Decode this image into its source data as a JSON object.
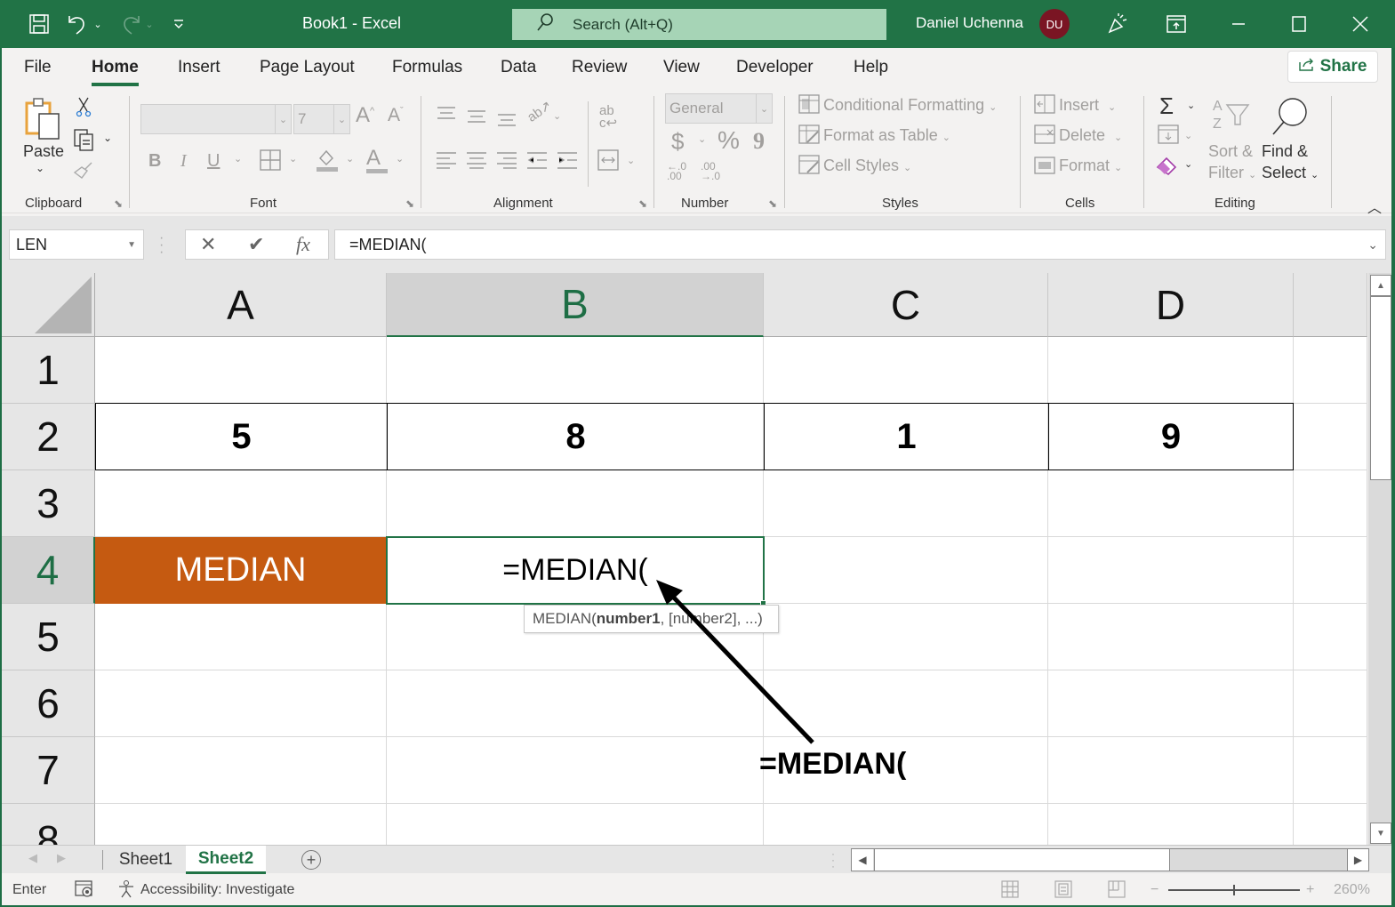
{
  "titlebar": {
    "title": "Book1  -  Excel",
    "search_placeholder": "Search (Alt+Q)",
    "user_name": "Daniel Uchenna",
    "user_initials": "DU"
  },
  "menu": {
    "tabs": [
      "File",
      "Home",
      "Insert",
      "Page Layout",
      "Formulas",
      "Data",
      "Review",
      "View",
      "Developer",
      "Help"
    ],
    "active_tab": "Home",
    "share_label": "Share"
  },
  "ribbon": {
    "clipboard": {
      "label": "Clipboard",
      "paste": "Paste"
    },
    "font": {
      "label": "Font",
      "font_name": "",
      "font_size": "7",
      "bold": "B",
      "italic": "I",
      "underline": "U"
    },
    "alignment": {
      "label": "Alignment"
    },
    "number": {
      "label": "Number",
      "format": "General",
      "currency": "$",
      "percent": "%",
      "comma": "9"
    },
    "styles": {
      "label": "Styles",
      "conditional_formatting": "Conditional Formatting",
      "format_as_table": "Format as Table",
      "cell_styles": "Cell Styles"
    },
    "cells": {
      "label": "Cells",
      "insert": "Insert",
      "delete": "Delete",
      "format": "Format"
    },
    "editing": {
      "label": "Editing",
      "sort_filter_1": "Sort &",
      "sort_filter_2": "Filter",
      "find_select_1": "Find &",
      "find_select_2": "Select"
    }
  },
  "formula_bar": {
    "name_box": "LEN",
    "cancel": "✕",
    "enter": "✔",
    "fx": "fx",
    "formula": "=MEDIAN("
  },
  "sheet": {
    "columns": [
      "A",
      "B",
      "C",
      "D"
    ],
    "selected_column": "B",
    "rows": [
      "1",
      "2",
      "3",
      "4",
      "5",
      "6",
      "7",
      "8"
    ],
    "selected_row": "4",
    "cells": {
      "A2": "5",
      "B2": "8",
      "C2": "1",
      "D2": "9",
      "A4": "MEDIAN",
      "B4": "=MEDIAN("
    },
    "tooltip": {
      "fn": "MEDIAN(",
      "arg_bold": "number1",
      "rest": ", [number2], ...)"
    },
    "annotation": "=MEDIAN(",
    "accent_fill": "#c55a11"
  },
  "sheet_tabs": [
    "Sheet1",
    "Sheet2"
  ],
  "active_sheet": "Sheet2",
  "statusbar": {
    "mode": "Enter",
    "accessibility": "Accessibility: Investigate",
    "zoom": "260%"
  },
  "colors": {
    "brand": "#217346",
    "avatar": "#7a1523"
  }
}
